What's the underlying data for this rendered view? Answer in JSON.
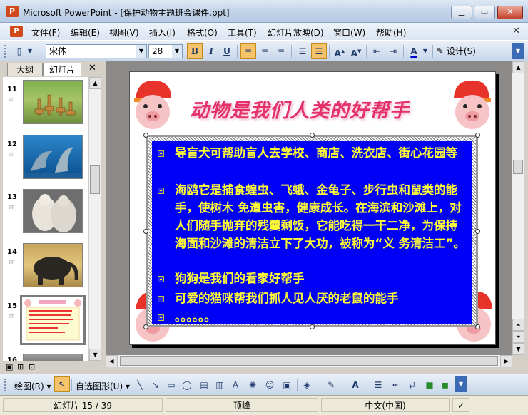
{
  "window": {
    "app_name": "Microsoft PowerPoint",
    "document": "[保护动物主题班会课件.ppt]",
    "title": "Microsoft PowerPoint - [保护动物主题班会课件.ppt]",
    "min_label": "▁",
    "max_label": "▭",
    "close_label": "✕"
  },
  "menu": {
    "items": [
      "文件(F)",
      "编辑(E)",
      "视图(V)",
      "插入(I)",
      "格式(O)",
      "工具(T)",
      "幻灯片放映(D)",
      "窗口(W)",
      "帮助(H)"
    ],
    "close_label": "✕"
  },
  "toolbar": {
    "font_name": "宋体",
    "font_size": "28",
    "bold": "B",
    "italic": "I",
    "underline": "U",
    "design_label": "设计(S)",
    "font_color": "#0000cc"
  },
  "panel": {
    "tabs": [
      "大纲",
      "幻灯片"
    ],
    "close_label": "✕",
    "thumbnails": [
      {
        "number": "11",
        "subject": "giraffes"
      },
      {
        "number": "12",
        "subject": "dolphins"
      },
      {
        "number": "13",
        "subject": "polar bears"
      },
      {
        "number": "14",
        "subject": "elephant"
      },
      {
        "number": "15",
        "subject": "current slide"
      },
      {
        "number": "16",
        "subject": "animals"
      }
    ],
    "selected": "15"
  },
  "slide": {
    "title": "动物是我们人类的好帮手",
    "bullets": [
      "导盲犬可帮助盲人去学校、商店、洗衣店、街心花园等",
      "海鸥它是捕食蝗虫、飞蛾、金龟子、步行虫和鼠类的能手，使树木 免遭虫害，健康成长。在海滨和沙滩上，对人们随手抛弃的残羹剩饭，它能吃得一干二净，为保持海面和沙滩的清洁立下了大功，被称为“义 务清洁工”。",
      "狗狗是我们的看家好帮手",
      "可爱的猫咪帮我们抓人见人厌的老鼠的能手",
      "。。。。。。"
    ],
    "title_color": "#e4316b",
    "box_color": "#0000f7",
    "text_color": "#ffff33"
  },
  "drawing": {
    "draw_label": "绘图(R)",
    "autoshapes_label": "自选图形(U)"
  },
  "status": {
    "slide_position": "幻灯片 15 / 39",
    "design": "顶峰",
    "language": "中文(中国)"
  }
}
